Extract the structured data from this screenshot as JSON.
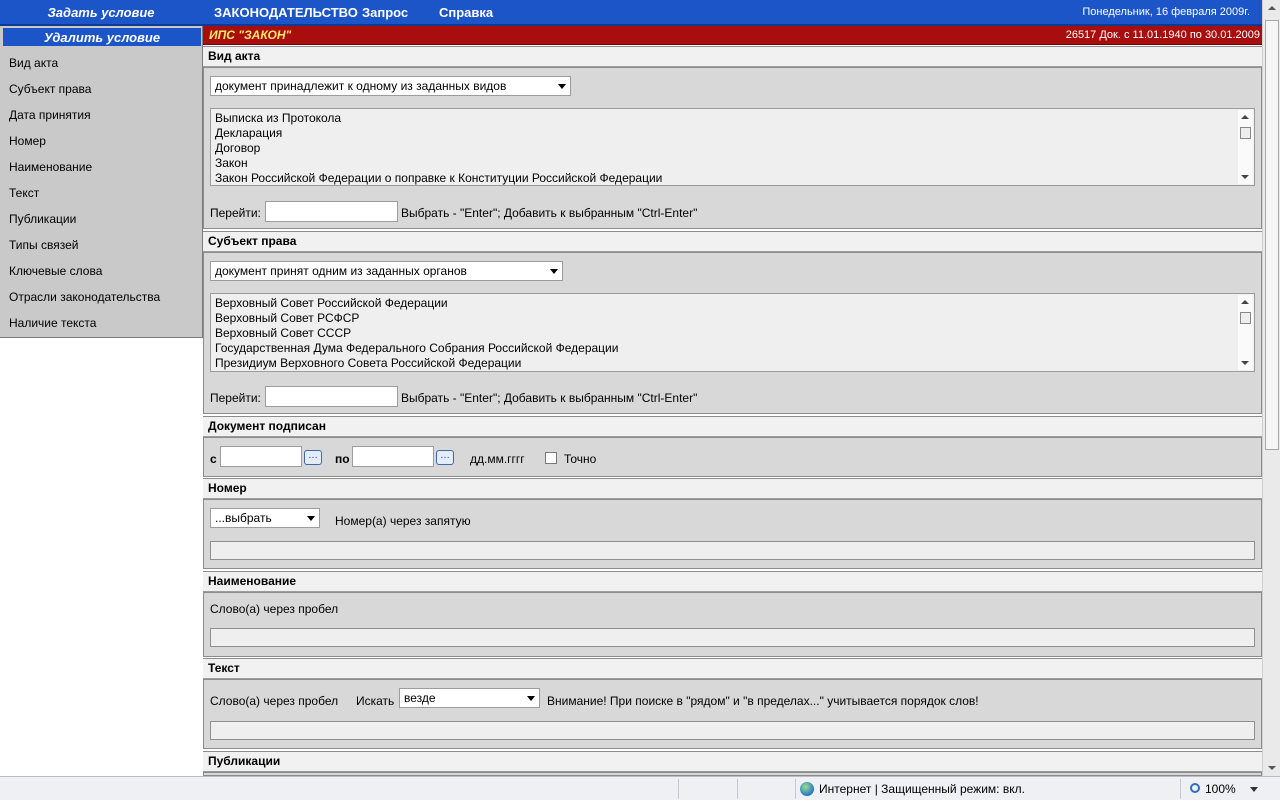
{
  "topbar": {
    "set_condition": "Задать условие",
    "menu": [
      "ЗАКОНОДАТЕЛЬСТВО",
      "Запрос",
      "Справка"
    ],
    "date": "Понедельник, 16 февраля 2009г."
  },
  "sidebar": {
    "delete_condition": "Удалить условие",
    "items": [
      "Вид акта",
      "Субъект права",
      "Дата принятия",
      "Номер",
      "Наименование",
      "Текст",
      "Публикации",
      "Типы связей",
      "Ключевые слова",
      "Отрасли законодательства",
      "Наличие текста"
    ]
  },
  "header": {
    "title": "ИПС \"ЗАКОН\"",
    "count": "26517 Док. с 11.01.1940 по 30.01.2009"
  },
  "act_type": {
    "heading": "Вид акта",
    "mode": "документ принадлежит к одному из заданных видов",
    "options": [
      "Выписка из Протокола",
      "Декларация",
      "Договор",
      "Закон",
      "Закон Российской Федерации о поправке к Конституции Российской Федерации"
    ],
    "goto_label": "Перейти:",
    "goto_value": "",
    "hint": "Выбрать - \"Enter\"; Добавить к выбранным \"Ctrl-Enter\""
  },
  "subject": {
    "heading": "Субъект права",
    "mode": "документ принят одним из заданных органов",
    "options": [
      "Верховный Совет Российской Федерации",
      "Верховный Совет РСФСР",
      "Верховный Совет СССР",
      "Государственная Дума Федерального Собрания Российской Федерации",
      "Президиум Верховного Совета Российской Федерации"
    ],
    "goto_label": "Перейти:",
    "goto_value": "",
    "hint": "Выбрать - \"Enter\"; Добавить к выбранным \"Ctrl-Enter\""
  },
  "signed": {
    "heading": "Документ подписан",
    "from_label": "с",
    "to_label": "по",
    "from_value": "",
    "to_value": "",
    "date_format": "дд.мм.гггг",
    "exact_label": "Точно",
    "dots": "…"
  },
  "number": {
    "heading": "Номер",
    "select_value": "...выбрать",
    "hint": "Номер(а) через запятую",
    "value": ""
  },
  "name": {
    "heading": "Наименование",
    "hint": "Слово(а) через пробел",
    "value": ""
  },
  "text": {
    "heading": "Текст",
    "hint": "Слово(а) через пробел",
    "search_label": "Искать",
    "search_value": "везде",
    "warning": "Внимание! При поиске в \"рядом\" и \"в пределах...\" учитывается порядок слов!",
    "value": ""
  },
  "publications": {
    "heading": "Публикации"
  },
  "statusbar": {
    "zone": "Интернет | Защищенный режим: вкл.",
    "zoom": "100%"
  }
}
